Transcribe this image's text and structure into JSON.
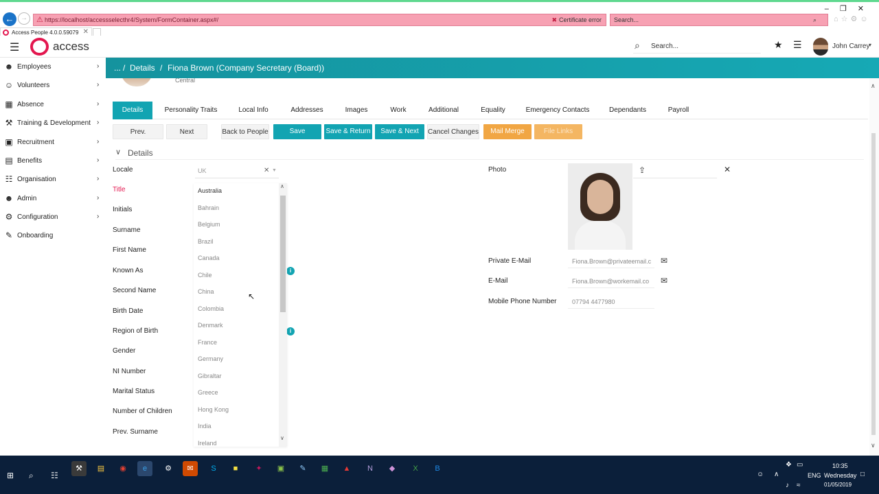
{
  "browser": {
    "url": "https://localhost/accessselecthr4/System/FormContainer.aspx#/",
    "cert_error": "Certificate error",
    "search_placeholder": "Search...",
    "tab_title": "Access People 4.0.0.59079"
  },
  "header": {
    "brand": "access",
    "search_placeholder": "Search...",
    "user_name": "John Carrey"
  },
  "sidebar": {
    "items": [
      {
        "label": "Employees",
        "icon": "users-icon"
      },
      {
        "label": "Volunteers",
        "icon": "user-group-icon"
      },
      {
        "label": "Absence",
        "icon": "calendar-icon"
      },
      {
        "label": "Training & Development",
        "icon": "training-icon"
      },
      {
        "label": "Recruitment",
        "icon": "briefcase-icon"
      },
      {
        "label": "Benefits",
        "icon": "book-icon"
      },
      {
        "label": "Organisation",
        "icon": "sitemap-icon"
      },
      {
        "label": "Admin",
        "icon": "person-icon"
      },
      {
        "label": "Configuration",
        "icon": "gear-icon"
      },
      {
        "label": "Onboarding",
        "icon": "pencil-icon"
      }
    ]
  },
  "breadcrumb": {
    "ellipsis": "...",
    "sep1": "/",
    "section": "Details",
    "sep2": "/",
    "person": "Fiona Brown (Company Secretary (Board))"
  },
  "person": {
    "subtitle": "Central"
  },
  "tabs": [
    "Details",
    "Personality Traits",
    "Local Info",
    "Addresses",
    "Images",
    "Work",
    "Additional",
    "Equality",
    "Emergency Contacts",
    "Dependants",
    "Payroll"
  ],
  "actions": {
    "prev": "Prev.",
    "next": "Next",
    "back": "Back to People",
    "save": "Save",
    "save_return": "Save & Return",
    "save_next": "Save & Next",
    "cancel": "Cancel Changes",
    "mail_merge": "Mail Merge",
    "file_links": "File Links"
  },
  "details": {
    "section_title": "Details",
    "locale_label": "Locale",
    "locale_value": "UK",
    "fields": [
      "Title",
      "Initials",
      "Surname",
      "First Name",
      "Known As",
      "Second Name",
      "Birth Date",
      "Region of Birth",
      "Gender",
      "NI Number",
      "Marital Status",
      "Number of Children",
      "Prev. Surname"
    ],
    "locale_options": [
      "Australia",
      "Bahrain",
      "Belgium",
      "Brazil",
      "Canada",
      "Chile",
      "China",
      "Colombia",
      "Denmark",
      "France",
      "Germany",
      "Gibraltar",
      "Greece",
      "Hong Kong",
      "India",
      "Ireland"
    ]
  },
  "right": {
    "photo_label": "Photo",
    "private_email_label": "Private E-Mail",
    "private_email_value": "Fiona.Brown@privateemail.c",
    "email_label": "E-Mail",
    "email_value": "Fiona.Brown@workemail.co",
    "mobile_label": "Mobile Phone Number",
    "mobile_value": "07794 4477980"
  },
  "taskbar": {
    "time": "10:35",
    "day": "Wednesday",
    "date": "01/05/2019",
    "lang": "ENG"
  }
}
